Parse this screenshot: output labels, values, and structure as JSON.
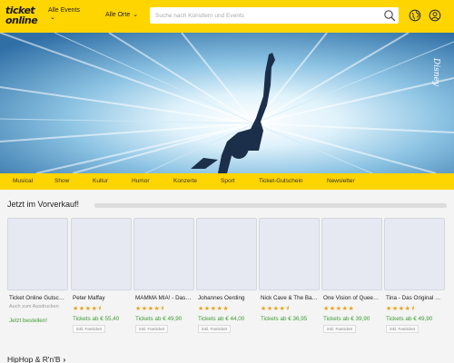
{
  "header": {
    "logo_line1": "ticket",
    "logo_line2": "online",
    "nav": [
      {
        "label": "Alle Events",
        "chevron": "⌄"
      },
      {
        "label": "Alle Orte",
        "chevron": "⌄"
      }
    ],
    "search_placeholder": "Suche nach Künstlern und Events",
    "icons": [
      "search-icon",
      "globe-icon",
      "user-icon"
    ]
  },
  "hero": {
    "watermark": "Disney"
  },
  "categories": [
    "Musical",
    "Show",
    "Kultur",
    "Humor",
    "Konzerte",
    "Sport",
    "Ticket-Gutschein",
    "Newsletter"
  ],
  "presale": {
    "title": "Jetzt im Vorverkauf!",
    "voucher": {
      "name": "Ticket Online Gutsc…",
      "note": "Auch zum Ausdrucken",
      "cta": "Jetzt bestellen!"
    },
    "events": [
      {
        "name": "Peter Maffay",
        "rating": 4.5,
        "stars": "★★★★⯨",
        "price": "Tickets ab € 55,40",
        "fee": "inkl. Fanticket"
      },
      {
        "name": "MAMMA MIA! - Das…",
        "rating": 4.5,
        "stars": "★★★★⯨",
        "price": "Tickets ab € 49,90",
        "fee": "inkl. Fanticket"
      },
      {
        "name": "Johannes Oerding",
        "rating": 5,
        "stars": "★★★★★",
        "price": "Tickets ab € 44,00",
        "fee": "inkl. Fanticket"
      },
      {
        "name": "Nick Cave & The Ba…",
        "rating": 4.5,
        "stars": "★★★★⯨",
        "price": "Tickets ab € 36,95",
        "fee": ""
      },
      {
        "name": "One Vision of Quee…",
        "rating": 5,
        "stars": "★★★★★",
        "price": "Tickets ab € 39,90",
        "fee": "inkl. Fanticket"
      },
      {
        "name": "Tina - Das Original …",
        "rating": 4.5,
        "stars": "★★★★⯨",
        "price": "Tickets ab € 49,90",
        "fee": "inkl. Fanticket"
      }
    ]
  },
  "section2": {
    "title": "HipHop & R'n'B",
    "arrow": "›"
  },
  "colors": {
    "brand_yellow": "#ffd500",
    "price_green": "#3f9c35",
    "star": "#e8a317"
  }
}
